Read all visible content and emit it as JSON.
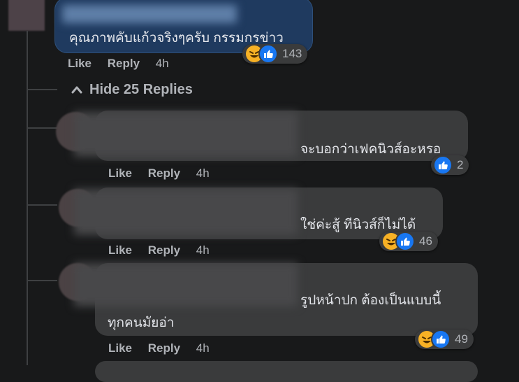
{
  "top_comment": {
    "text": "คุณภาพคับแก้วจริงๆครับ กรรมกรข่าว",
    "actions": {
      "like": "Like",
      "reply": "Reply",
      "time": "4h"
    },
    "reaction_count": "143",
    "reactions": [
      "haha-icon",
      "like-icon"
    ]
  },
  "hide_replies": {
    "label": "Hide 25 Replies"
  },
  "replies": [
    {
      "lines": [
        "จะบอกว่าเฟคนิวส์อะหรอ"
      ],
      "actions": {
        "like": "Like",
        "reply": "Reply",
        "time": "4h"
      },
      "reaction_count": "2",
      "reactions": [
        "like-icon"
      ]
    },
    {
      "lines": [
        "ใช่ค่ะสู้ ทีนิวส์ก็ไม่ได้"
      ],
      "actions": {
        "like": "Like",
        "reply": "Reply",
        "time": "4h"
      },
      "reaction_count": "46",
      "reactions": [
        "haha-icon",
        "like-icon"
      ]
    },
    {
      "lines": [
        "รูปหน้าปก ต้องเป็นแบบนี้",
        "ทุกคนมัยอ่า"
      ],
      "actions": {
        "like": "Like",
        "reply": "Reply",
        "time": "4h"
      },
      "reaction_count": "49",
      "reactions": [
        "haha-icon",
        "like-icon"
      ]
    }
  ],
  "colors": {
    "background": "#18191a",
    "bubble": "#3a3b3c",
    "top_bubble": "#1f3a5f",
    "like": "#1877f2",
    "haha": "#f7b125",
    "secondary_text": "#b0b3b8"
  }
}
